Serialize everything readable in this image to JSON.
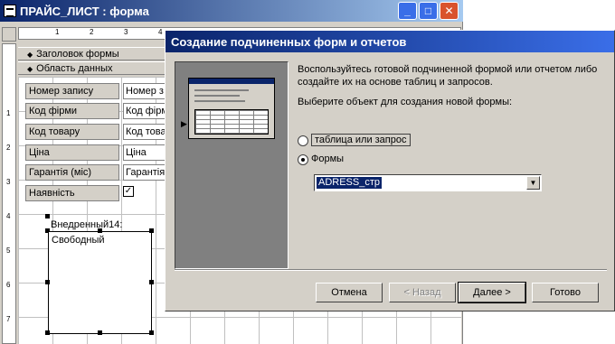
{
  "bg_window": {
    "title": "ПРАЙС_ЛИСТ : форма",
    "ruler_marks": [
      "1",
      "2",
      "3",
      "4"
    ],
    "left_ruler_marks": [
      "1",
      "2",
      "3",
      "4",
      "5",
      "6",
      "7"
    ],
    "sections": {
      "header": "Заголовок формы",
      "detail": "Область данных"
    },
    "fields": [
      {
        "label": "Номер запису",
        "value": "Номер з"
      },
      {
        "label": "Код фірми",
        "value": "Код фірм"
      },
      {
        "label": "Код товару",
        "value": "Код това"
      },
      {
        "label": "Ціна",
        "value": "Ціна"
      },
      {
        "label": "Гарантія (міс)",
        "value": "Гарантія"
      }
    ],
    "checkbox_label": "Наявність",
    "subform_label": "Внедренный14:",
    "subform_text": "Свободный"
  },
  "dialog": {
    "title": "Создание подчиненных форм и отчетов",
    "intro": "Воспользуйтесь готовой подчиненной формой или отчетом либо создайте их на основе таблиц и запросов.",
    "prompt": "Выберите объект для создания новой формы:",
    "options": {
      "tables": "таблица или запрос",
      "forms": "Формы"
    },
    "selected_form": "ADRESS_стр",
    "buttons": {
      "cancel": "Отмена",
      "back": "< Назад",
      "next": "Далее >",
      "finish": "Готово"
    }
  },
  "colors": {
    "title_bar": "#0a246a",
    "dialog_bg": "#d4d0c8"
  }
}
